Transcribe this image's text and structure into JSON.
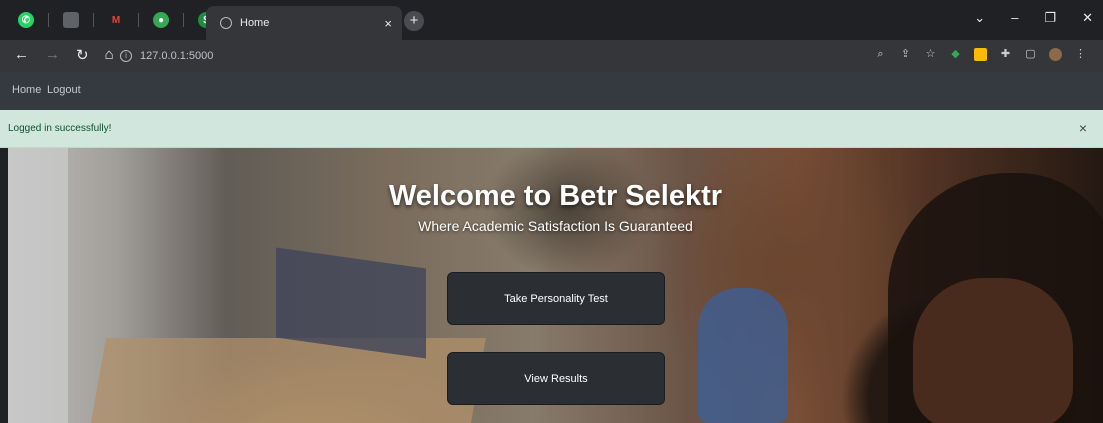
{
  "browser": {
    "tab_title": "Home",
    "tab_close": "×",
    "new_tab": "+",
    "url": "127.0.0.1:5000",
    "window_controls": [
      "⌄",
      "–",
      "❐",
      "✕"
    ]
  },
  "navbar": {
    "home": "Home",
    "logout": "Logout"
  },
  "alert": {
    "message": "Logged in successfully!",
    "close": "×"
  },
  "hero": {
    "title": "Welcome to Betr Selektr",
    "subtitle": "Where Academic Satisfaction Is Guaranteed",
    "primary_button": "Take Personality Test",
    "secondary_button": "View Results"
  },
  "colors": {
    "navbar_bg": "#343a40",
    "alert_bg": "#d1e7dd",
    "button_bg": "#2b2f33"
  }
}
